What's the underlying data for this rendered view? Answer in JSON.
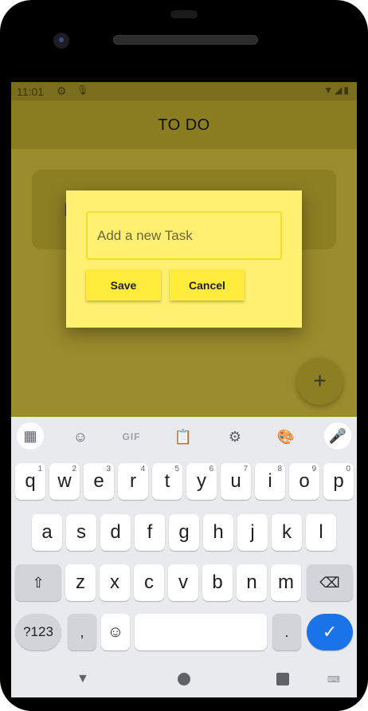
{
  "status_bar": {
    "time": "11:01",
    "settings_icon": "gear-icon",
    "mic_icon": "mic-small-icon",
    "right_icons": "wifi signal battery"
  },
  "app_bar": {
    "title": "TO DO"
  },
  "task_card": {
    "partial_text": "I"
  },
  "fab": {
    "label": "+"
  },
  "dialog": {
    "input_placeholder": "Add a new Task",
    "input_value": "",
    "save_label": "Save",
    "cancel_label": "Cancel"
  },
  "keyboard": {
    "toolbar": [
      "apps-grid-icon",
      "sticker-icon",
      "GIF",
      "clipboard-icon",
      "settings-icon",
      "palette-icon",
      "mic-icon"
    ],
    "row1": [
      {
        "k": "q",
        "h": "1"
      },
      {
        "k": "w",
        "h": "2"
      },
      {
        "k": "e",
        "h": "3"
      },
      {
        "k": "r",
        "h": "4"
      },
      {
        "k": "t",
        "h": "5"
      },
      {
        "k": "y",
        "h": "6"
      },
      {
        "k": "u",
        "h": "7"
      },
      {
        "k": "i",
        "h": "8"
      },
      {
        "k": "o",
        "h": "9"
      },
      {
        "k": "p",
        "h": "0"
      }
    ],
    "row2": [
      "a",
      "s",
      "d",
      "f",
      "g",
      "h",
      "j",
      "k",
      "l"
    ],
    "row3": [
      "z",
      "x",
      "c",
      "v",
      "b",
      "n",
      "m"
    ],
    "num_key": "?123",
    "comma": ",",
    "period": ".",
    "gif": "GIF"
  },
  "colors": {
    "accent": "#ffeb3b",
    "dialog_bg": "#fff071",
    "app_bar": "#8b7d22",
    "enter_key": "#1a73e8"
  }
}
